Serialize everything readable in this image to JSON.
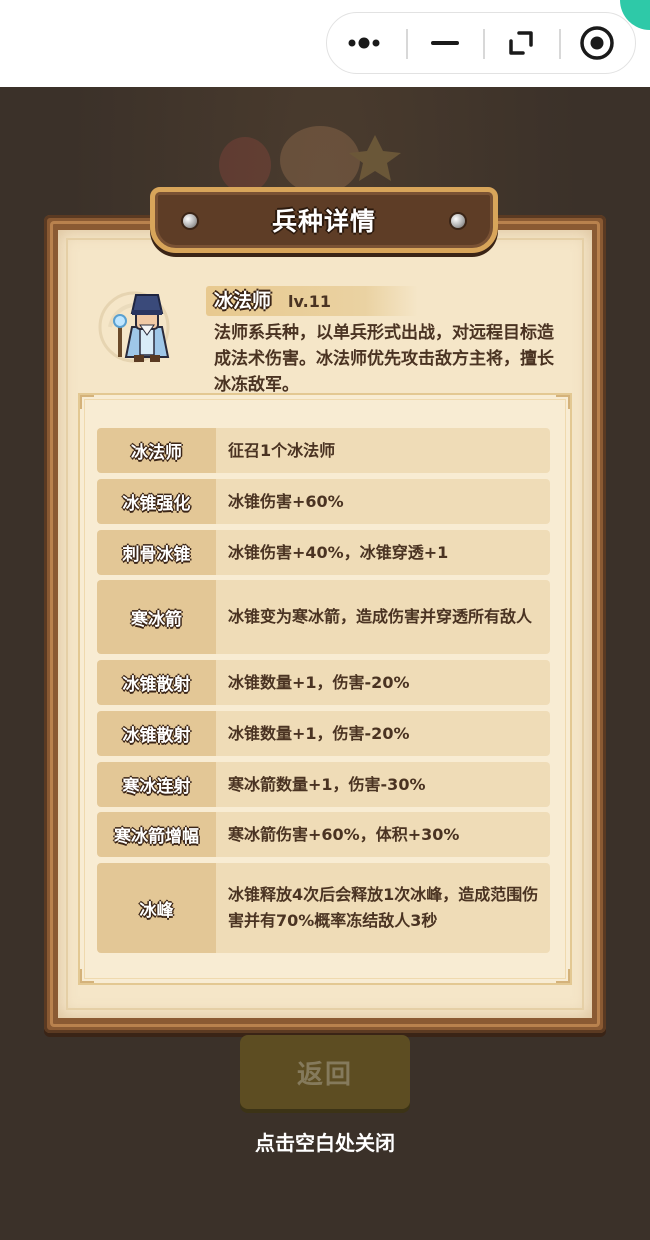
{
  "window_controls": {
    "more_icon": "more-dots-icon",
    "minimize_icon": "minimize-icon",
    "restore_icon": "restore-icon",
    "close_icon": "target-close-icon"
  },
  "dialog": {
    "title": "兵种详情"
  },
  "unit": {
    "name": "冰法师",
    "level": "lv.11",
    "description": "法师系兵种，以单兵形式出战，对远程目标造成法术伤害。冰法师优先攻击敌方主将，擅长冰冻敌军。",
    "avatar_icon": "ice-mage-avatar"
  },
  "skills": [
    {
      "name": "冰法师",
      "desc": "征召1个冰法师"
    },
    {
      "name": "冰锥强化",
      "desc": "冰锥伤害+60%"
    },
    {
      "name": "刺骨冰锥",
      "desc": "冰锥伤害+40%，冰锥穿透+1"
    },
    {
      "name": "寒冰箭",
      "desc": "冰锥变为寒冰箭，造成伤害并穿透所有敌人"
    },
    {
      "name": "冰锥散射",
      "desc": "冰锥数量+1，伤害-20%"
    },
    {
      "name": "冰锥散射",
      "desc": "冰锥数量+1，伤害-20%"
    },
    {
      "name": "寒冰连射",
      "desc": "寒冰箭数量+1，伤害-30%"
    },
    {
      "name": "寒冰箭增幅",
      "desc": "寒冰箭伤害+60%，体积+30%"
    },
    {
      "name": "冰峰",
      "desc": "冰锥释放4次后会释放1次冰峰，造成范围伤害并有70%概率冻结敌人3秒"
    }
  ],
  "footer": {
    "back_label": "返回",
    "close_hint": "点击空白处关闭"
  },
  "colors": {
    "background": "#3b3129",
    "panel_paper": "#f5e6c8",
    "row_name_bg": "#e3c796",
    "row_desc_bg": "#efdcb7",
    "text_brown": "#4a3322",
    "back_button": "#5d4d22"
  }
}
